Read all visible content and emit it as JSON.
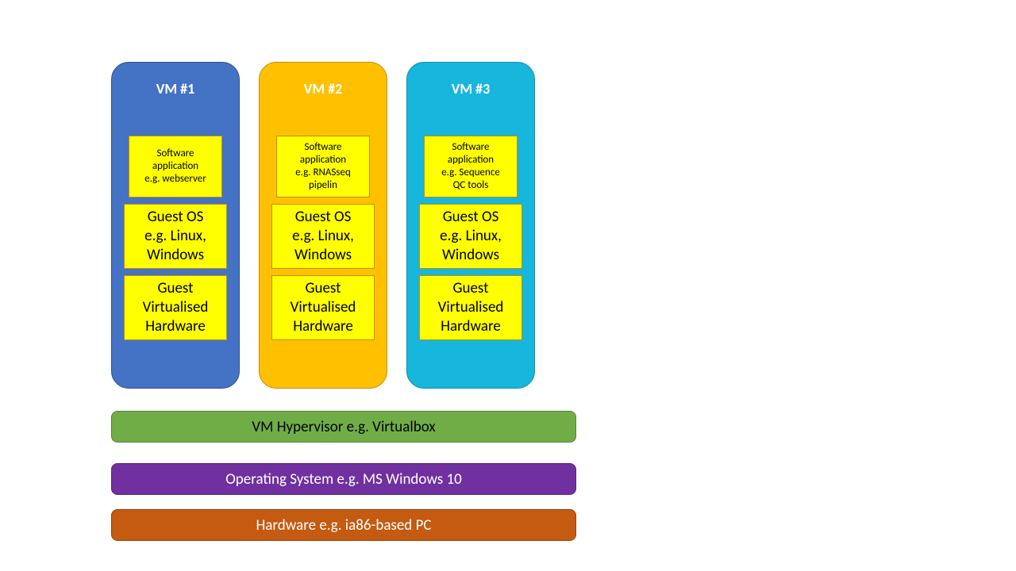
{
  "vms": [
    {
      "title": "VM #1",
      "app": "Software\napplication\ne.g.  webserver",
      "os": "Guest OS\ne.g. Linux,\nWindows",
      "hw": "Guest\nVirtualised\nHardware"
    },
    {
      "title": "VM #2",
      "app": "Software\napplication\ne.g.  RNASseq\npipelin",
      "os": "Guest OS\ne.g. Linux,\nWindows",
      "hw": "Guest\nVirtualised\nHardware"
    },
    {
      "title": "VM #3",
      "app": "Software\napplication\ne.g.  Sequence\nQC tools",
      "os": "Guest OS\ne.g. Linux,\nWindows",
      "hw": "Guest\nVirtualised\nHardware"
    }
  ],
  "layers": {
    "hypervisor": "VM Hypervisor e.g. Virtualbox",
    "os": "Operating System e.g. MS Windows 10",
    "hardware": "Hardware e.g. ia86-based PC"
  }
}
